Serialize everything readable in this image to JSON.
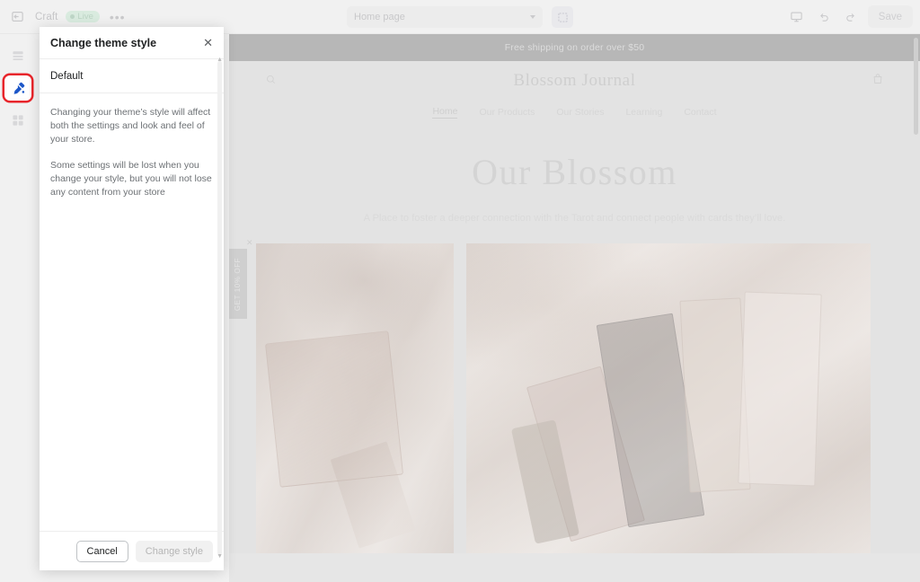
{
  "toolbar": {
    "back_icon": "exit-icon",
    "theme_name": "Craft",
    "live_badge": "Live",
    "more_menu": "•••",
    "page_selector_value": "Home page",
    "inspector_icon": "inspector-icon",
    "device_icon": "desktop-icon",
    "undo_icon": "undo-icon",
    "redo_icon": "redo-icon",
    "save_label": "Save"
  },
  "rail": {
    "items": [
      {
        "name": "sections-icon",
        "label": "Sections"
      },
      {
        "name": "paint-roller-icon",
        "label": "Theme settings"
      },
      {
        "name": "apps-grid-icon",
        "label": "Apps"
      }
    ],
    "active_index": 1,
    "highlight_color": "#e8252b",
    "active_icon_color": "#1c56c8"
  },
  "modal": {
    "title": "Change theme style",
    "close_icon": "close-icon",
    "style_option": "Default",
    "note_1": "Changing your theme’s style will affect both the settings and look and feel of your store.",
    "note_2": "Some settings will be lost when you change your style, but you will not lose any content from your store",
    "cancel_label": "Cancel",
    "confirm_label": "Change style"
  },
  "preview": {
    "announcement": "Free shipping on order over $50",
    "store_name": "Blossom Journal",
    "search_icon": "search-icon",
    "cart_icon": "shopping-bag-icon",
    "nav": [
      {
        "label": "Home",
        "active": true
      },
      {
        "label": "Our Products",
        "active": false
      },
      {
        "label": "Our Stories",
        "active": false
      },
      {
        "label": "Learning",
        "active": false
      },
      {
        "label": "Contact",
        "active": false
      }
    ],
    "hero_heading": "Our Blossom",
    "hero_subtitle": "A Place to foster a deeper connection with the Tarot and connect people with cards they’ll love.",
    "promo_tab": "GET 10% OFF",
    "promo_close_icon": "close-icon"
  }
}
